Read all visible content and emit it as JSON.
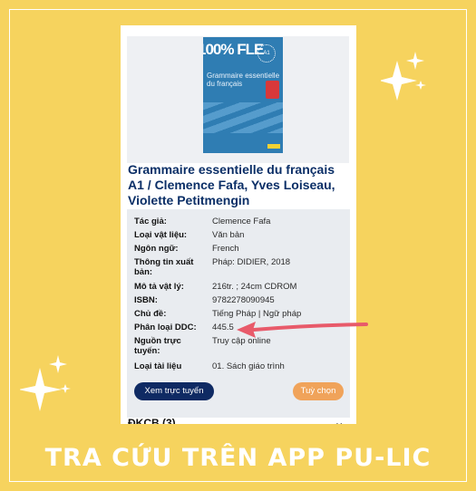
{
  "book": {
    "cover_logo": "100% FLE",
    "cover_level": "A1",
    "cover_title": "Grammaire essentielle du français",
    "title": "Grammaire essentielle du français A1 / Clemence Fafa, Yves Loiseau, Violette Petitmengin"
  },
  "details": [
    {
      "label": "Tác giả:",
      "value": "Clemence Fafa"
    },
    {
      "label": "Loại vật liệu:",
      "value": "Văn bản"
    },
    {
      "label": "Ngôn ngữ:",
      "value": "French"
    },
    {
      "label": "Thông tin xuất bản:",
      "value": "Pháp: DIDIER, 2018"
    },
    {
      "label": "Mô tả vật lý:",
      "value": "216tr. ; 24cm CDROM"
    },
    {
      "label": "ISBN:",
      "value": "9782278090945"
    },
    {
      "label": "Chủ đề:",
      "value": "Tiếng Pháp | Ngữ pháp"
    },
    {
      "label": "Phân loại DDC:",
      "value": "445.5"
    },
    {
      "label": "Nguồn trực tuyến:",
      "value": "Truy cập online"
    },
    {
      "label": "Loại tài liệu",
      "value": "01. Sách giáo trình"
    }
  ],
  "buttons": {
    "online": "Xem trực tuyến",
    "options": "Tuỳ chọn"
  },
  "section": {
    "dkcb": "ĐKCB (3)"
  },
  "banner": "TRA CỨU TRÊN APP PU-LIC",
  "colors": {
    "background": "#f6d35e",
    "title": "#0b2f67",
    "online_button": "#0f2a63",
    "options_button": "#f0a35a",
    "arrow": "#e85a6a"
  }
}
